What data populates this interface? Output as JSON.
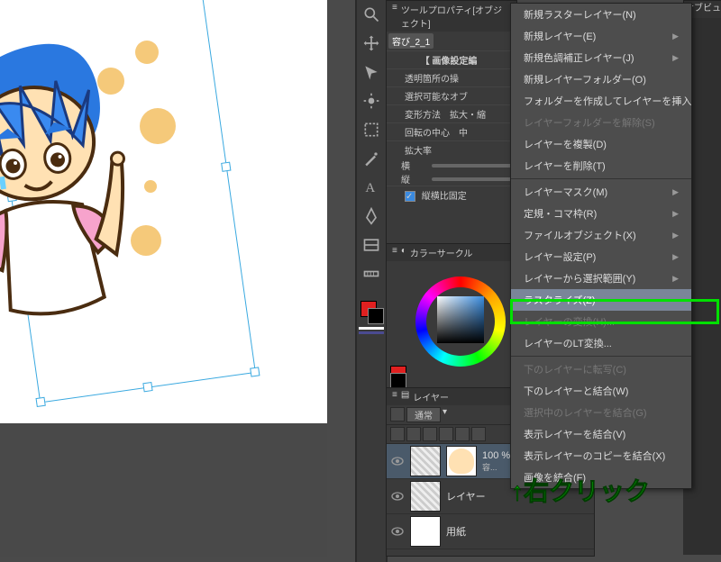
{
  "tool_property": {
    "header": "ツールプロパティ[オブジェクト]",
    "tab": "容び_2_1",
    "section": "【 画像設定編",
    "row1": "透明箇所の操",
    "row2": "選択可能なオブ",
    "row3_label": "変形方法",
    "row3_val": "拡大・縮",
    "row4_label": "回転の中心",
    "row4_val": "中",
    "zoom_label": "拡大率",
    "zoom_h": "横",
    "zoom_v": "縦",
    "ratio_lock": "縦横比固定"
  },
  "color_circle": {
    "header": "カラーサークル"
  },
  "layers": {
    "header": "レイヤー",
    "blend": "通常",
    "items": [
      {
        "name": "100 %",
        "sub": "容..."
      },
      {
        "name": "レイヤー"
      },
      {
        "name": "用紙"
      }
    ]
  },
  "subview": {
    "tab": "サブビュー"
  },
  "context_menu": {
    "items": [
      {
        "label": "新規ラスターレイヤー(N)"
      },
      {
        "label": "新規レイヤー(E)",
        "sub": true
      },
      {
        "label": "新規色調補正レイヤー(J)",
        "sub": true
      },
      {
        "label": "新規レイヤーフォルダー(O)"
      },
      {
        "label": "フォルダーを作成してレイヤーを挿入(F)"
      },
      {
        "label": "レイヤーフォルダーを解除(S)",
        "disabled": true
      },
      {
        "label": "レイヤーを複製(D)"
      },
      {
        "label": "レイヤーを削除(T)"
      },
      {
        "sep": true
      },
      {
        "label": "レイヤーマスク(M)",
        "sub": true
      },
      {
        "label": "定規・コマ枠(R)",
        "sub": true
      },
      {
        "label": "ファイルオブジェクト(X)",
        "sub": true
      },
      {
        "label": "レイヤー設定(P)",
        "sub": true
      },
      {
        "label": "レイヤーから選択範囲(Y)",
        "sub": true
      },
      {
        "label": "ラスタライズ(Z)",
        "highlight": true
      },
      {
        "label": "レイヤーの変換(H)...",
        "disabled": true
      },
      {
        "label": "レイヤーのLT変換..."
      },
      {
        "sep": true
      },
      {
        "label": "下のレイヤーに転写(C)",
        "disabled": true
      },
      {
        "label": "下のレイヤーと結合(W)"
      },
      {
        "label": "選択中のレイヤーを結合(G)",
        "disabled": true
      },
      {
        "label": "表示レイヤーを結合(V)"
      },
      {
        "label": "表示レイヤーのコピーを結合(X)"
      },
      {
        "label": "画像を統合(F)"
      }
    ]
  },
  "annotation": "↑右クリック"
}
